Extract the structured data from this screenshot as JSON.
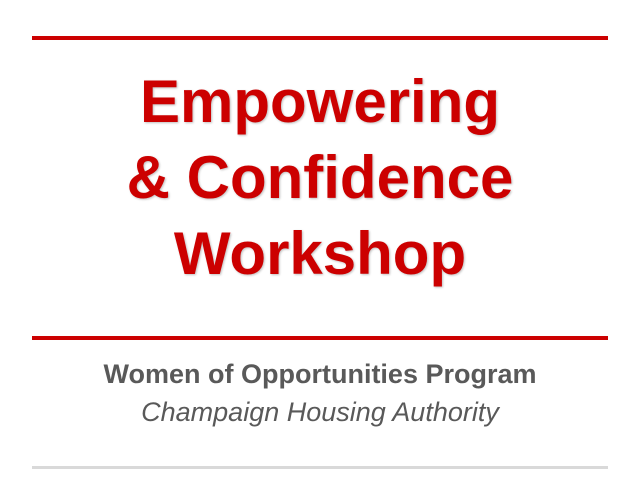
{
  "slide": {
    "title_lines": [
      "Empowering",
      "& Confidence",
      "Workshop"
    ],
    "subtitle": "Women of Opportunities Program",
    "organization": "Champaign Housing Authority"
  },
  "colors": {
    "accent": "#cc0000",
    "text_gray": "#595959",
    "rule_gray": "#d9d9d9",
    "background": "#ffffff"
  }
}
